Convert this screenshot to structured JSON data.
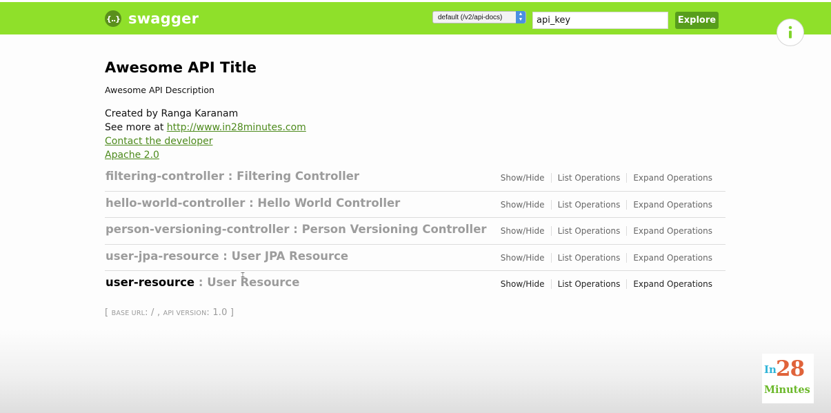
{
  "header": {
    "logo_icon": "{..}",
    "logo_text": "swagger",
    "spec_select": "default (/v2/api-docs)",
    "api_key_value": "api_key",
    "explore_label": "Explore",
    "info_icon": "info-icon"
  },
  "info": {
    "title": "Awesome API Title",
    "description": "Awesome API Description",
    "created_by": "Created by Ranga Karanam",
    "see_more_prefix": "See more at ",
    "see_more_link": "http://www.in28minutes.com",
    "contact_link": "Contact the developer",
    "license_link": "Apache 2.0"
  },
  "resources": [
    {
      "name": "filtering-controller",
      "sep": " : ",
      "desc": "Filtering Controller",
      "show_hide": "Show/Hide",
      "list_ops": "List Operations",
      "expand_ops": "Expand Operations"
    },
    {
      "name": "hello-world-controller",
      "sep": " : ",
      "desc": "Hello World Controller",
      "show_hide": "Show/Hide",
      "list_ops": "List Operations",
      "expand_ops": "Expand Operations"
    },
    {
      "name": "person-versioning-controller",
      "sep": " : ",
      "desc": "Person Versioning Controller",
      "show_hide": "Show/Hide",
      "list_ops": "List Operations",
      "expand_ops": "Expand Operations"
    },
    {
      "name": "user-jpa-resource",
      "sep": " : ",
      "desc": "User JPA Resource",
      "show_hide": "Show/Hide",
      "list_ops": "List Operations",
      "expand_ops": "Expand Operations"
    },
    {
      "name": "user-resource",
      "sep": " : ",
      "desc": "User Resource",
      "show_hide": "Show/Hide",
      "list_ops": "List Operations",
      "expand_ops": "Expand Operations"
    }
  ],
  "footer": {
    "open": "[ ",
    "base_url_label": "base url",
    "base_url_value": ": / , ",
    "api_version_label": "api version",
    "api_version_value": ": 1.0 ]"
  },
  "brand": {
    "in": "In",
    "num": "28",
    "minutes": "Minutes"
  },
  "colors": {
    "header_green": "#8fe02a",
    "link_green": "#4d8a1c",
    "explore_green": "#579d1c",
    "resource_gray": "#9c9c9c"
  }
}
